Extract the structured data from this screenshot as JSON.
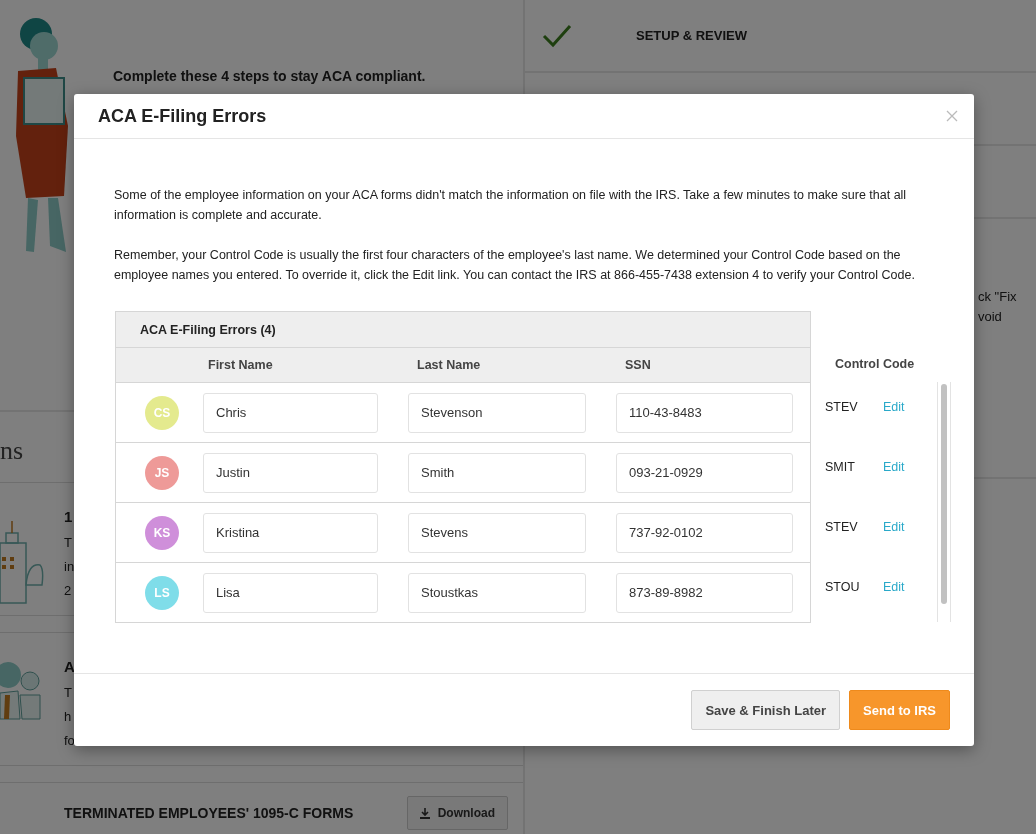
{
  "background_page": {
    "intro": "Complete these 4 steps to stay ACA compliant.",
    "steps": [
      {
        "label": "SETUP & REVIEW",
        "completed": true
      }
    ],
    "step_note_lines": [
      "ck \"Fix",
      "void"
    ],
    "section_heading": "ns",
    "cards": [
      {
        "kind": "building",
        "lines": [
          "1",
          "T",
          "in",
          "2"
        ]
      },
      {
        "kind": "people",
        "lines": [
          "A",
          "T",
          "h",
          "fo"
        ]
      },
      {
        "kind": "download",
        "title": "TERMINATED EMPLOYEES' 1095-C FORMS",
        "button": "Download"
      }
    ]
  },
  "modal": {
    "title": "ACA E-Filing Errors",
    "paragraphs": [
      "Some of the employee information on your ACA forms didn't match the information on file with the IRS. Take a few minutes to make sure that all information is complete and accurate.",
      "Remember, your Control Code is usually the first four characters of the employee's last name. We determined your Control Code based on the employee names you entered. To override it, click the Edit link. You can contact the IRS at 866-455-7438 extension 4 to verify your Control Code."
    ],
    "table": {
      "title": "ACA E-Filing Errors (4)",
      "columns": [
        "First Name",
        "Last Name",
        "SSN",
        "Control Code"
      ],
      "rows": [
        {
          "initials": "CS",
          "color": "#e4ea8e",
          "first_name": "Chris",
          "last_name": "Stevenson",
          "ssn": "110-43-8483",
          "control_code": "STEV",
          "action": "Edit"
        },
        {
          "initials": "JS",
          "color": "#ee9a98",
          "first_name": "Justin",
          "last_name": "Smith",
          "ssn": "093-21-0929",
          "control_code": "SMIT",
          "action": "Edit"
        },
        {
          "initials": "KS",
          "color": "#cf8fda",
          "first_name": "Kristina",
          "last_name": "Stevens",
          "ssn": "737-92-0102",
          "control_code": "STEV",
          "action": "Edit"
        },
        {
          "initials": "LS",
          "color": "#7fdde9",
          "first_name": "Lisa",
          "last_name": "Stoustkas",
          "ssn": "873-89-8982",
          "control_code": "STOU",
          "action": "Edit"
        }
      ]
    },
    "buttons": [
      {
        "label": "Save & Finish Later",
        "kind": "secondary"
      },
      {
        "label": "Send to IRS",
        "kind": "primary"
      }
    ]
  }
}
